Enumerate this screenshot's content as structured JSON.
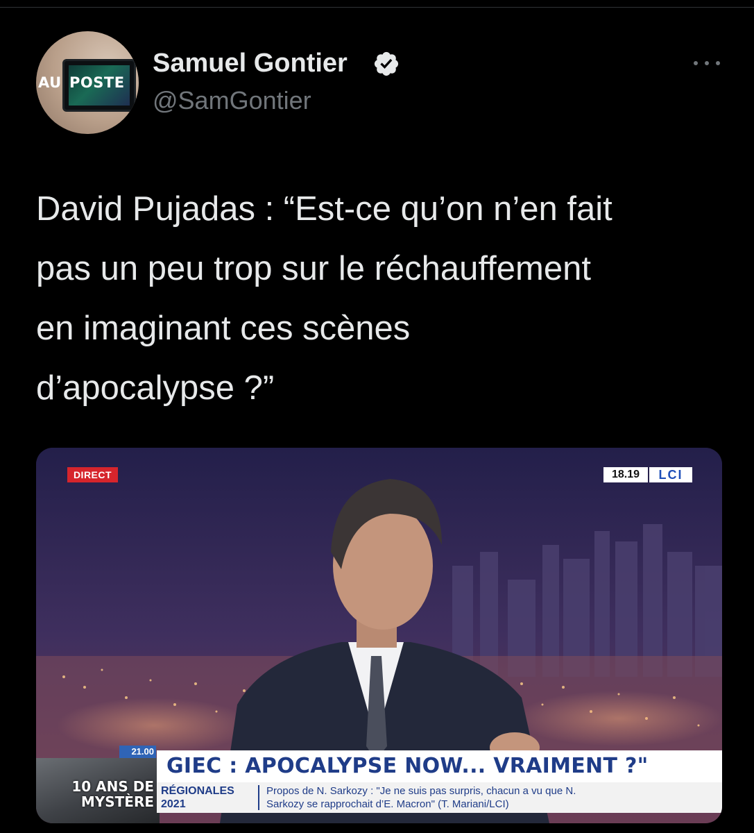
{
  "author": {
    "display_name": "Samuel Gontier",
    "handle": "@SamGontier",
    "verified": true,
    "avatar_text": [
      "AU",
      "POSTE"
    ]
  },
  "tweet": {
    "text_lines": [
      "David Pujadas : “Est-ce qu’on n’en fait",
      "pas un peu trop sur le réchauffement",
      "en imaginant ces scènes",
      "d’apocalypse ?”"
    ]
  },
  "media": {
    "live_badge": "DIRECT",
    "time": "18.19",
    "channel_logo": "LCI",
    "schedule_time": "21.00",
    "promo_lines": [
      "10 ANS DE",
      "MYSTÈRE"
    ],
    "headline": "GIEC : APOCALYPSE NOW... VRAIMENT ?\"",
    "ticker_label_lines": [
      "RÉGIONALES",
      "2021"
    ],
    "ticker_lines": [
      "Propos de N. Sarkozy : \"Je ne suis pas surpris, chacun a vu que N.",
      "Sarkozy se rapprochait d’E. Macron\" (T. Mariani/LCI)"
    ]
  },
  "icons": {
    "verified": "verified-badge-icon",
    "more": "more-options-icon"
  },
  "colors": {
    "background": "#000000",
    "text": "#e7e9ea",
    "secondary_text": "#71767b",
    "lci_blue": "#1f3c88",
    "direct_red": "#d6252c"
  }
}
